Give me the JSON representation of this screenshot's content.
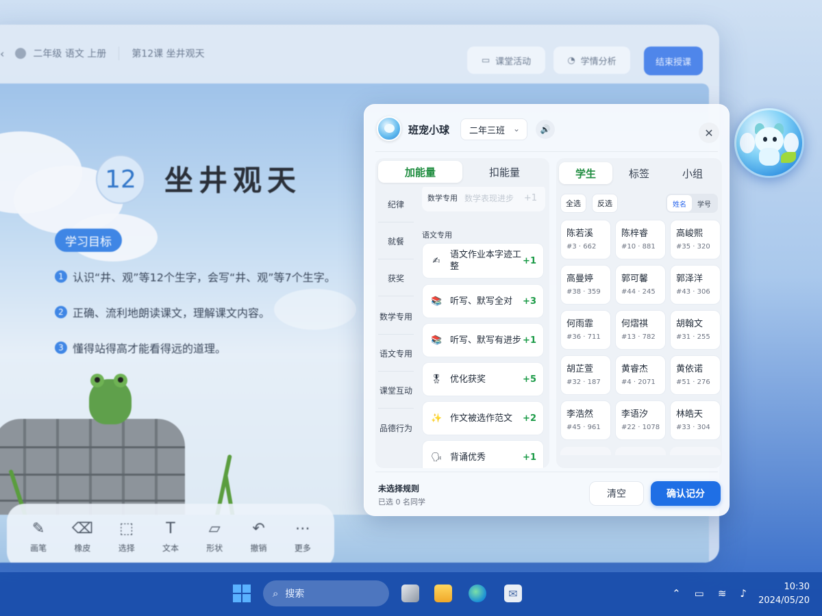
{
  "background_app": {
    "breadcrumb_course": "二年级 语文 上册",
    "breadcrumb_lesson": "第12课 坐井观天",
    "btn_activity": "课堂活动",
    "btn_analysis": "学情分析",
    "btn_end": "结束授课",
    "lesson_number": "12",
    "lesson_title": "坐井观天",
    "goal_badge": "学习目标",
    "goals": [
      {
        "n": "1",
        "text": "认识“井、观”等12个生字，会写“井、观”等7个生字。"
      },
      {
        "n": "2",
        "text": "正确、流利地朗读课文，理解课文内容。"
      },
      {
        "n": "3",
        "text": "懂得站得高才能看得远的道理。"
      }
    ],
    "tools": [
      {
        "icon": "pen-icon",
        "glyph": "✎",
        "label": "画笔"
      },
      {
        "icon": "eraser-icon",
        "glyph": "⌫",
        "label": "橡皮"
      },
      {
        "icon": "select-icon",
        "glyph": "⬚",
        "label": "选择"
      },
      {
        "icon": "text-icon",
        "glyph": "T",
        "label": "文本"
      },
      {
        "icon": "shape-icon",
        "glyph": "▱",
        "label": "形状"
      },
      {
        "icon": "undo-icon",
        "glyph": "↶",
        "label": "撤销"
      },
      {
        "icon": "more-icon",
        "glyph": "⋯",
        "label": "更多"
      }
    ]
  },
  "panel": {
    "app_title": "班宠小球",
    "class_selected": "二年三班",
    "close_glyph": "✕",
    "sound_glyph": "🔊",
    "energy_tabs": [
      "加能量",
      "扣能量"
    ],
    "energy_active": 0,
    "categories": [
      "纪律",
      "就餐",
      "获奖",
      "数学专用",
      "语文专用",
      "课堂互动",
      "品德行为"
    ],
    "top_rule": {
      "label": "数学专用",
      "placeholder": "数学表现进步",
      "points": "+1"
    },
    "section_label": "语文专用",
    "rules": [
      {
        "icon": "✍",
        "text": "语文作业本字迹工整",
        "points": "+1"
      },
      {
        "icon": "📚",
        "text": "听写、默写全对",
        "points": "+3"
      },
      {
        "icon": "📚",
        "text": "听写、默写有进步",
        "points": "+1"
      },
      {
        "icon": "🎖",
        "text": "优化获奖",
        "points": "+5"
      },
      {
        "icon": "✨",
        "text": "作文被选作范文",
        "points": "+2"
      },
      {
        "icon": "🗣",
        "text": "背诵优秀",
        "points": "+1"
      }
    ],
    "view_tabs": [
      "学生",
      "标签",
      "小组"
    ],
    "view_active": 0,
    "select_all": "全选",
    "select_invert": "反选",
    "sort_options": [
      "姓名",
      "学号"
    ],
    "sort_active": 0,
    "students": [
      {
        "name": "陈若溪",
        "meta": "#3 · 662"
      },
      {
        "name": "陈梓睿",
        "meta": "#10 · 881"
      },
      {
        "name": "高峻熙",
        "meta": "#35 · 320"
      },
      {
        "name": "高曼婷",
        "meta": "#38 · 359"
      },
      {
        "name": "郭可馨",
        "meta": "#44 · 245"
      },
      {
        "name": "郭泽洋",
        "meta": "#43 · 306"
      },
      {
        "name": "何雨霏",
        "meta": "#36 · 711"
      },
      {
        "name": "何熠祺",
        "meta": "#13 · 782"
      },
      {
        "name": "胡翰文",
        "meta": "#31 · 255"
      },
      {
        "name": "胡芷萱",
        "meta": "#32 · 187"
      },
      {
        "name": "黄睿杰",
        "meta": "#4 · 2071"
      },
      {
        "name": "黄依诺",
        "meta": "#51 · 276"
      },
      {
        "name": "李浩然",
        "meta": "#45 · 961"
      },
      {
        "name": "李语汐",
        "meta": "#22 · 1078"
      },
      {
        "name": "林皓天",
        "meta": "#33 · 304"
      }
    ],
    "footer_title": "未选择规则",
    "footer_sub": "已选 0 名同学",
    "btn_clear": "清空",
    "btn_confirm": "确认记分"
  },
  "taskbar": {
    "search_placeholder": "搜索",
    "time": "10:30",
    "date": "2024/05/20"
  },
  "colors": {
    "accent_blue": "#1f6fe5",
    "active_green": "#1e8c3f",
    "points_green": "#1a9a46",
    "taskbar": "#1a4eaa"
  }
}
